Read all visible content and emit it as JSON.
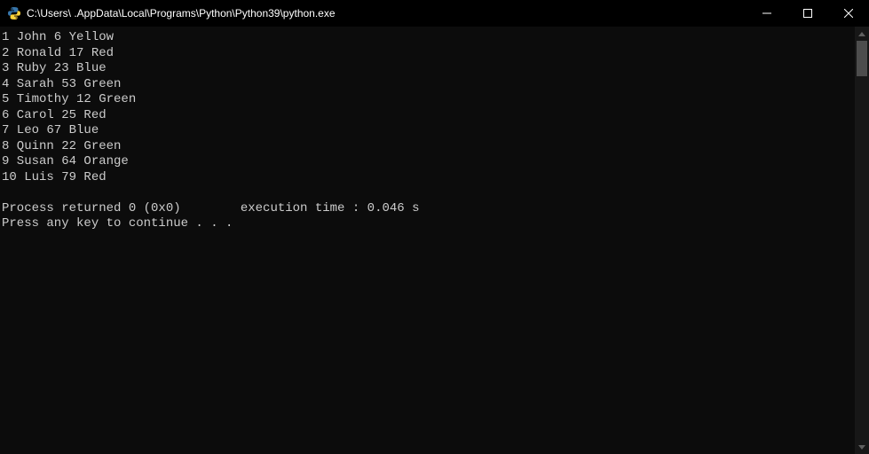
{
  "window": {
    "title": "C:\\Users\\      .AppData\\Local\\Programs\\Python\\Python39\\python.exe"
  },
  "output": {
    "lines": [
      "1 John 6 Yellow",
      "2 Ronald 17 Red",
      "3 Ruby 23 Blue",
      "4 Sarah 53 Green",
      "5 Timothy 12 Green",
      "6 Carol 25 Red",
      "7 Leo 67 Blue",
      "8 Quinn 22 Green",
      "9 Susan 64 Orange",
      "10 Luis 79 Red",
      "",
      "Process returned 0 (0x0)        execution time : 0.046 s",
      "Press any key to continue . . ."
    ]
  }
}
